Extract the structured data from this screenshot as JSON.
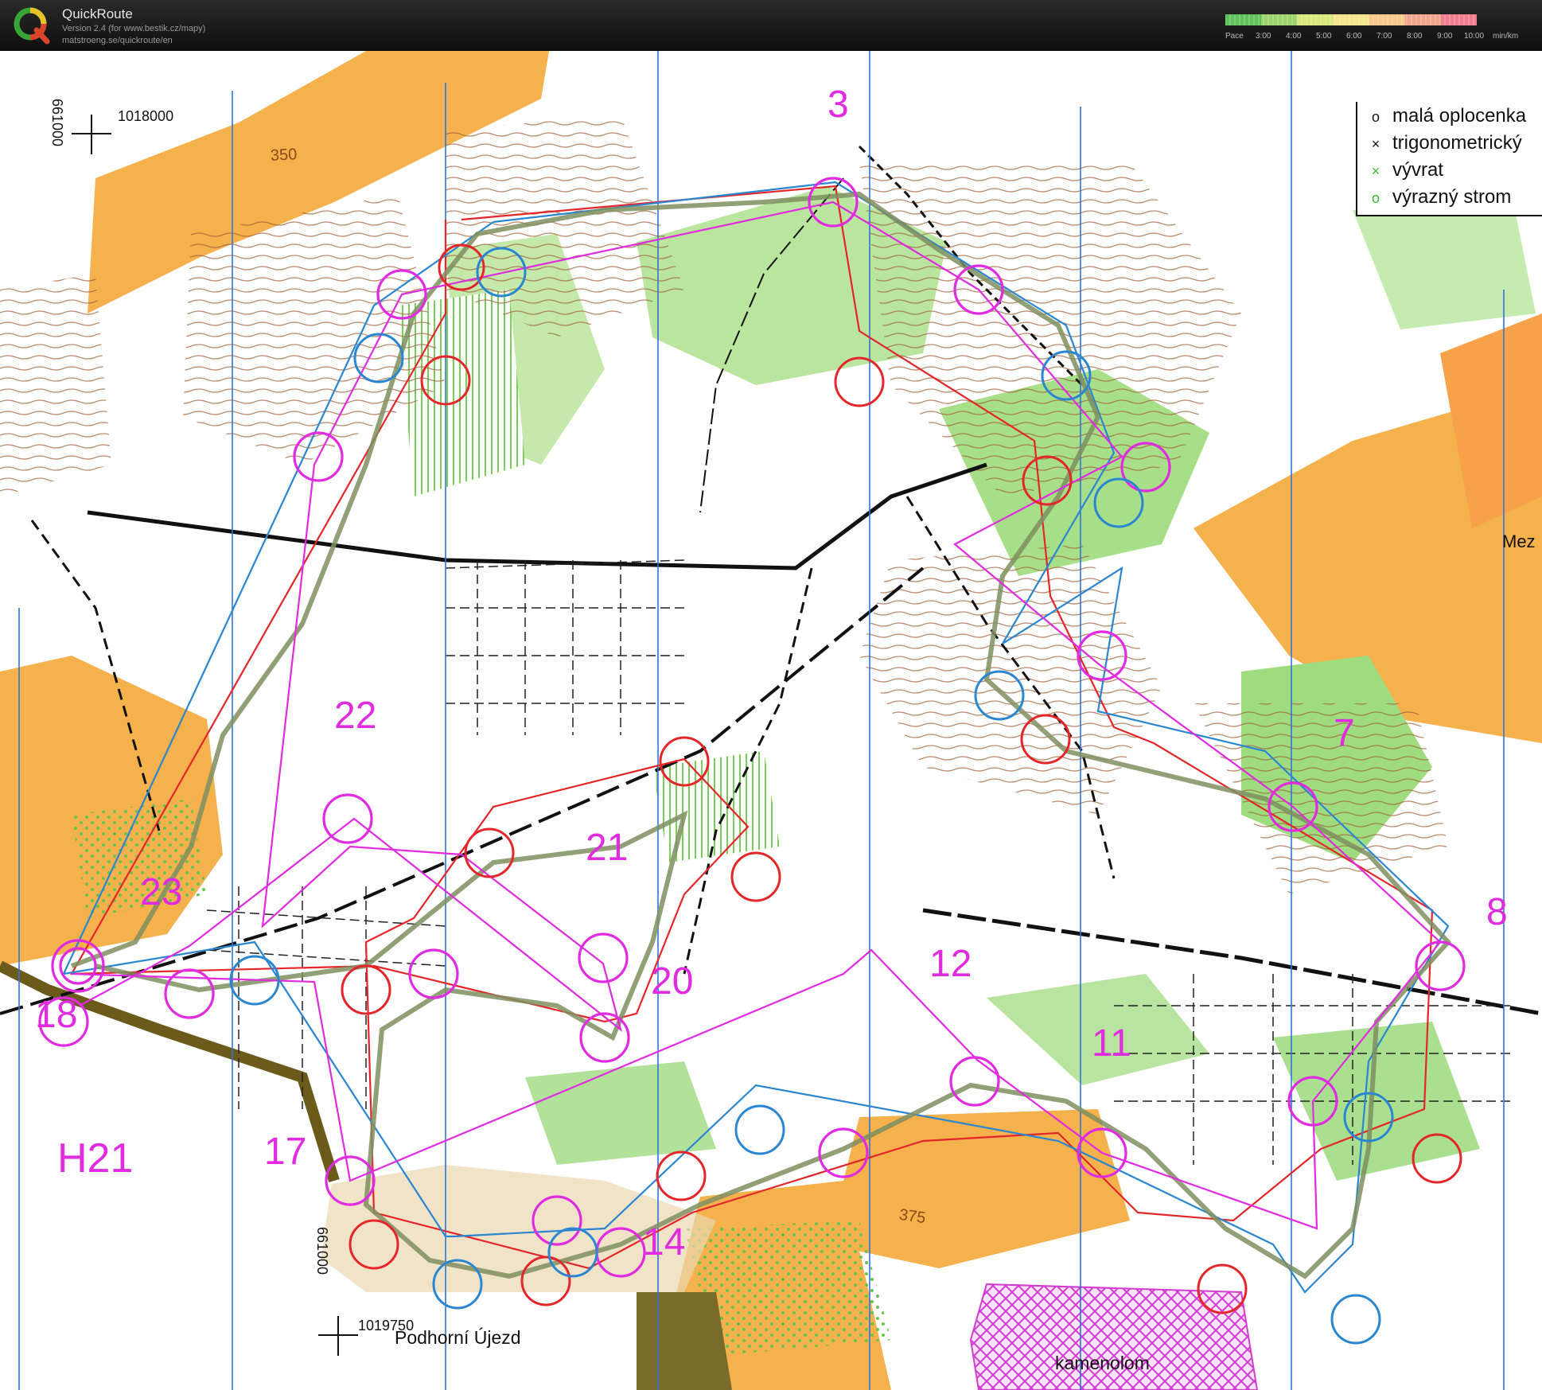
{
  "app": {
    "name": "QuickRoute",
    "version": "Version 2.4  (for www.bestik.cz/mapy)",
    "url": "matstroeng.se/quickroute/en"
  },
  "pace_scale": {
    "label": "Pace",
    "ticks": [
      "3:00",
      "4:00",
      "5:00",
      "6:00",
      "7:00",
      "8:00",
      "9:00",
      "10:00"
    ],
    "unit": "min/km",
    "colors": [
      "#5fc15a",
      "#9bd46c",
      "#d9e87b",
      "#f3e58a",
      "#f7c98a",
      "#f3a48c",
      "#f07e8e"
    ]
  },
  "legend": {
    "items": [
      {
        "symbol": "o",
        "label": "malá oplocenka",
        "color": "#111111"
      },
      {
        "symbol": "×",
        "label": "trigonometrický",
        "color": "#111111"
      },
      {
        "symbol": "×",
        "label": "vývrat",
        "color": "#3dbb2f"
      },
      {
        "symbol": "o",
        "label": "výrazný strom",
        "color": "#3dbb2f"
      }
    ]
  },
  "map": {
    "course_name": "H21",
    "place_names": [
      "Podhorní Újezd",
      "kamenolom",
      "Mez"
    ],
    "contour_values": [
      "350",
      "375"
    ],
    "coordinates": [
      "1018000",
      "661000",
      "1019750",
      "661000"
    ],
    "control_numbers": [
      "3",
      "7",
      "8",
      "11",
      "12",
      "14",
      "17",
      "18",
      "20",
      "21",
      "22",
      "23"
    ],
    "colors": {
      "course": "#e02be0",
      "route_red": "#e4262a",
      "route_blue": "#2a86d1",
      "gps_track": "#7f8f60",
      "open_land": "#f4b14c",
      "forest_green": "#8ed96d",
      "contour": "#9a5a2a",
      "quarry": "#e24fd8"
    }
  }
}
